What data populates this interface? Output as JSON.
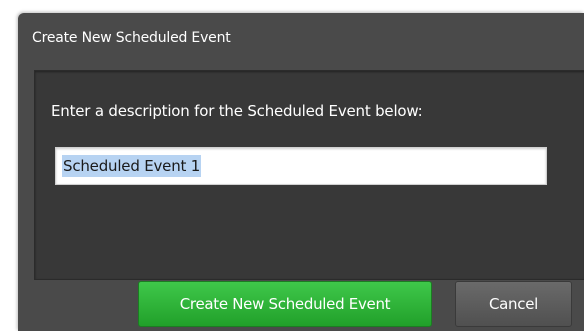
{
  "dialog": {
    "title": "Create New Scheduled Event",
    "prompt": "Enter a description for the Scheduled Event below:",
    "description_value": "Scheduled Event 1",
    "primary_button_label": "Create New Scheduled Event",
    "cancel_button_label": "Cancel"
  },
  "colors": {
    "dialog_bg": "#4a4a4a",
    "panel_bg": "#383838",
    "primary_button": "#2fb53a",
    "cancel_button": "#5c5c5c",
    "selection_highlight": "#b7d3f2"
  }
}
